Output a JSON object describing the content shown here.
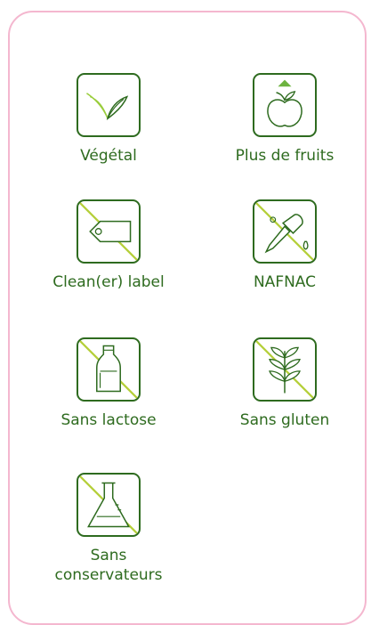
{
  "features": [
    {
      "label": "Végétal",
      "icon": "leaf-icon"
    },
    {
      "label": "Plus de fruits",
      "icon": "apple-arrow-up-icon"
    },
    {
      "label": "Clean(er) label",
      "icon": "price-tag-icon"
    },
    {
      "label": "NAFNAC",
      "icon": "dropper-no-icon"
    },
    {
      "label": "Sans lactose",
      "icon": "milk-bottle-no-icon"
    },
    {
      "label": "Sans gluten",
      "icon": "wheat-no-icon"
    },
    {
      "label": "Sans\nconservateurs",
      "icon": "flask-no-icon"
    }
  ],
  "colors": {
    "border_pink": "#f4b7cf",
    "green_dark": "#2e6b1f",
    "green_light": "#9acd3c",
    "strike": "#b5cf3a"
  }
}
